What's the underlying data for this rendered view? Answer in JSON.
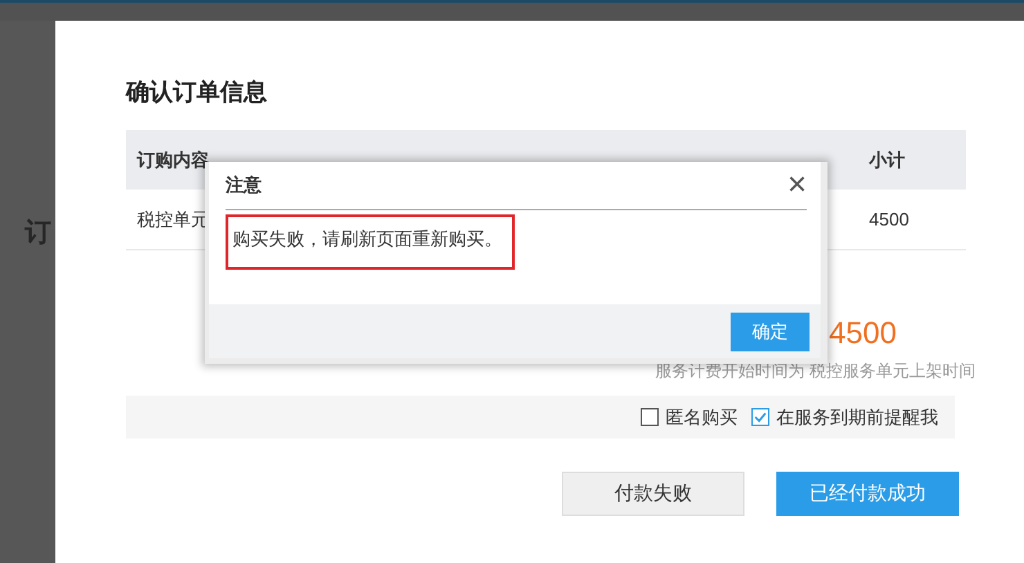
{
  "background_page": {
    "heading": "订"
  },
  "order_modal": {
    "title": "确认订单信息",
    "table": {
      "columns": [
        "订购内容",
        "小计"
      ],
      "rows": [
        {
          "cells": [
            "税控单元",
            "4500"
          ]
        }
      ]
    },
    "total": "4500",
    "note": "服务计费开始时间为 税控服务单元上架时间",
    "options": [
      {
        "label": "匿名购买",
        "checked": false
      },
      {
        "label": "在服务到期前提醒我",
        "checked": true
      }
    ],
    "buttons": [
      {
        "label": "付款失败",
        "kind": "secondary"
      },
      {
        "label": "已经付款成功",
        "kind": "primary"
      }
    ]
  },
  "alert_dialog": {
    "title": "注意",
    "close": "×",
    "message": "购买失败，请刷新页面重新购买。",
    "button": "确定"
  }
}
